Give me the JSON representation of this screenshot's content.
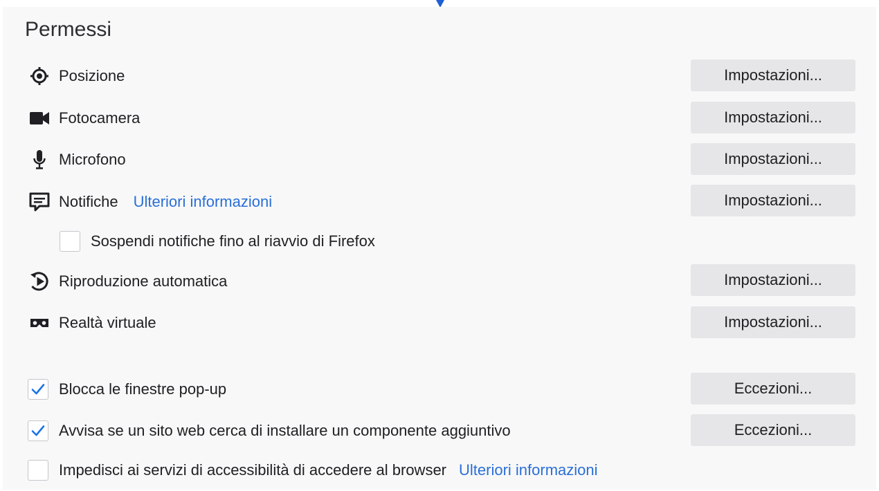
{
  "section_title": "Permessi",
  "permissions": [
    {
      "label": "Posizione",
      "icon": "location-icon",
      "button": "Impostazioni..."
    },
    {
      "label": "Fotocamera",
      "icon": "camera-icon",
      "button": "Impostazioni..."
    },
    {
      "label": "Microfono",
      "icon": "microphone-icon",
      "button": "Impostazioni..."
    },
    {
      "label": "Notifiche",
      "icon": "notification-icon",
      "link": "Ulteriori informazioni",
      "button": "Impostazioni..."
    },
    {
      "label": "Riproduzione automatica",
      "icon": "autoplay-icon",
      "button": "Impostazioni..."
    },
    {
      "label": "Realtà virtuale",
      "icon": "vr-headset-icon",
      "button": "Impostazioni..."
    }
  ],
  "pause_notifications": {
    "label": "Sospendi notifiche fino al riavvio di Firefox",
    "checked": false
  },
  "block_popups": {
    "label": "Blocca le finestre pop-up",
    "checked": true,
    "button": "Eccezioni..."
  },
  "warn_addons": {
    "label": "Avvisa se un sito web cerca di installare un componente aggiuntivo",
    "checked": true,
    "button": "Eccezioni..."
  },
  "block_accessibility": {
    "label": "Impedisci ai servizi di accessibilità di accedere al browser",
    "checked": false,
    "link": "Ulteriori informazioni"
  },
  "colors": {
    "link": "#2a6fd8",
    "checkmark": "#1a73e8",
    "button_bg": "#e6e6e8",
    "panel_bg": "#f8f8f8"
  }
}
